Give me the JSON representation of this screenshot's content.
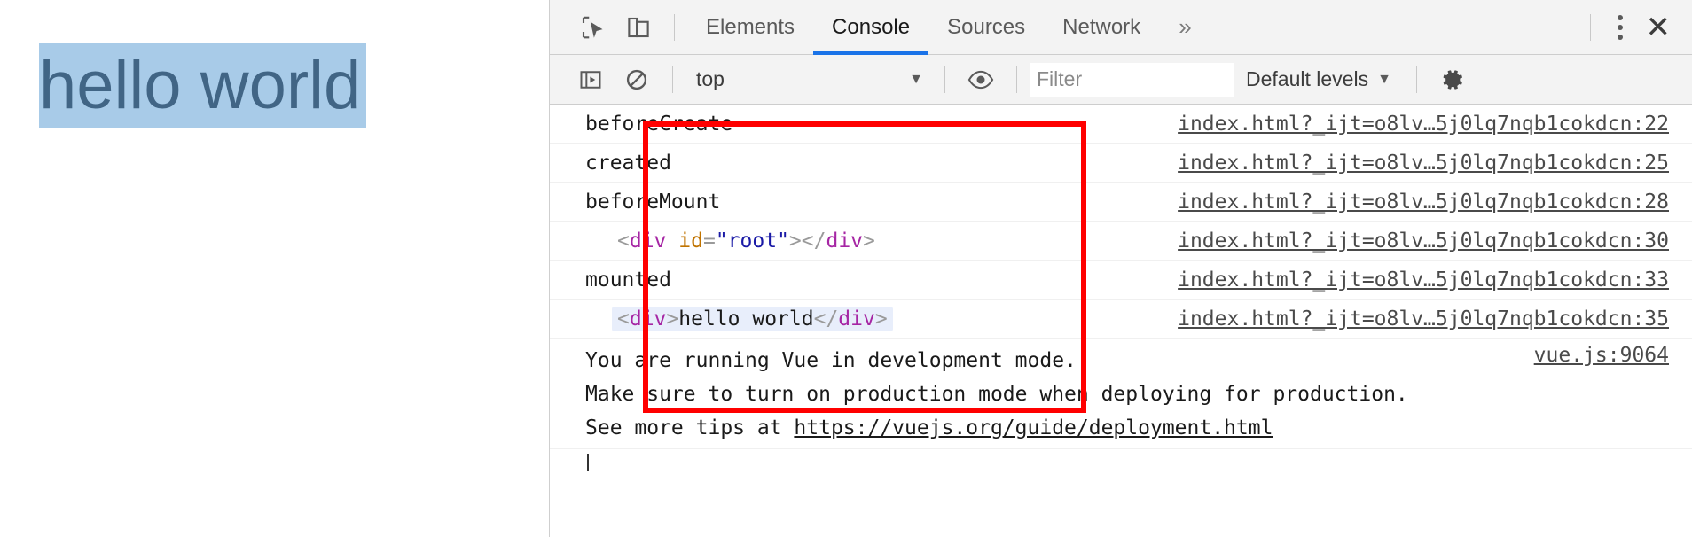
{
  "page": {
    "heading_text": "hello world",
    "selection_bg": "#a8cbe8",
    "text_color": "#416585"
  },
  "devtools": {
    "inspect_icon": "inspect-element-icon",
    "device_icon": "device-toolbar-icon",
    "tabs": [
      {
        "label": "Elements",
        "active": false
      },
      {
        "label": "Console",
        "active": true
      },
      {
        "label": "Sources",
        "active": false
      },
      {
        "label": "Network",
        "active": false
      }
    ],
    "more_tabs": "»",
    "kebab_icon": "more-options-icon",
    "close_icon": "close-icon",
    "accent_color": "#1a73e8"
  },
  "filterbar": {
    "sidebar_icon": "console-sidebar-icon",
    "clear_icon": "clear-console-icon",
    "context_value": "top",
    "context_caret": "▼",
    "eye_icon": "live-expression-icon",
    "filter_placeholder": "Filter",
    "filter_value": "",
    "levels_label": "Default levels",
    "levels_caret": "▼",
    "settings_icon": "gear-icon"
  },
  "console": {
    "rows": [
      {
        "kind": "text",
        "text": "beforeCreate",
        "indent": false,
        "source": "index.html?_ijt=o8lv…5j0lq7nqb1cokdcn:22"
      },
      {
        "kind": "text",
        "text": "created",
        "indent": false,
        "source": "index.html?_ijt=o8lv…5j0lq7nqb1cokdcn:25"
      },
      {
        "kind": "text",
        "text": "beforeMount",
        "indent": false,
        "source": "index.html?_ijt=o8lv…5j0lq7nqb1cokdcn:28"
      },
      {
        "kind": "node",
        "indent": true,
        "highlighted": false,
        "tokens": [
          {
            "t": "br",
            "v": "<"
          },
          {
            "t": "tag",
            "v": "div"
          },
          {
            "t": "text",
            "v": " "
          },
          {
            "t": "attr",
            "v": "id"
          },
          {
            "t": "eq",
            "v": "="
          },
          {
            "t": "val",
            "v": "\"root\""
          },
          {
            "t": "br",
            "v": ">"
          },
          {
            "t": "br",
            "v": "</"
          },
          {
            "t": "tag",
            "v": "div"
          },
          {
            "t": "br",
            "v": ">"
          }
        ],
        "source": "index.html?_ijt=o8lv…5j0lq7nqb1cokdcn:30"
      },
      {
        "kind": "text",
        "text": "mounted",
        "indent": false,
        "source": "index.html?_ijt=o8lv…5j0lq7nqb1cokdcn:33"
      },
      {
        "kind": "node",
        "indent": true,
        "highlighted": true,
        "tokens": [
          {
            "t": "br",
            "v": "<"
          },
          {
            "t": "tag",
            "v": "div"
          },
          {
            "t": "br",
            "v": ">"
          },
          {
            "t": "text",
            "v": "hello world"
          },
          {
            "t": "br",
            "v": "</"
          },
          {
            "t": "tag",
            "v": "div"
          },
          {
            "t": "br",
            "v": ">"
          }
        ],
        "source": "index.html?_ijt=o8lv…5j0lq7nqb1cokdcn:35"
      }
    ],
    "warning": {
      "line1": "You are running Vue in development mode.",
      "line2": "Make sure to turn on production mode when deploying for production.",
      "line3_prefix": "See more tips at ",
      "line3_url": "https://vuejs.org/guide/deployment.html",
      "source": "vue.js:9064"
    }
  },
  "annotation": {
    "shape": "rectangle",
    "color": "#ff0000"
  }
}
